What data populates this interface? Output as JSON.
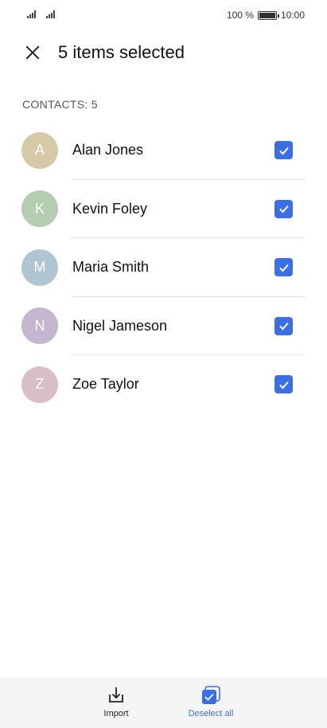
{
  "status_bar": {
    "battery_percent": "100 %",
    "time": "10:00"
  },
  "header": {
    "title": "5 items selected",
    "close_icon": "close-icon"
  },
  "section": {
    "label": "CONTACTS: 5"
  },
  "contacts": [
    {
      "initial": "A",
      "name": "Alan Jones",
      "avatar_color": "#d6c9a8",
      "checked": true
    },
    {
      "initial": "K",
      "name": "Kevin Foley",
      "avatar_color": "#b4ccb0",
      "checked": true
    },
    {
      "initial": "M",
      "name": "Maria Smith",
      "avatar_color": "#aec6d2",
      "checked": true
    },
    {
      "initial": "N",
      "name": "Nigel Jameson",
      "avatar_color": "#c4b6cf",
      "checked": true
    },
    {
      "initial": "Z",
      "name": "Zoe Taylor",
      "avatar_color": "#d8bfc6",
      "checked": true
    }
  ],
  "bottom_bar": {
    "import_label": "Import",
    "deselect_label": "Deselect all"
  },
  "colors": {
    "accent": "#3b6fe6"
  }
}
